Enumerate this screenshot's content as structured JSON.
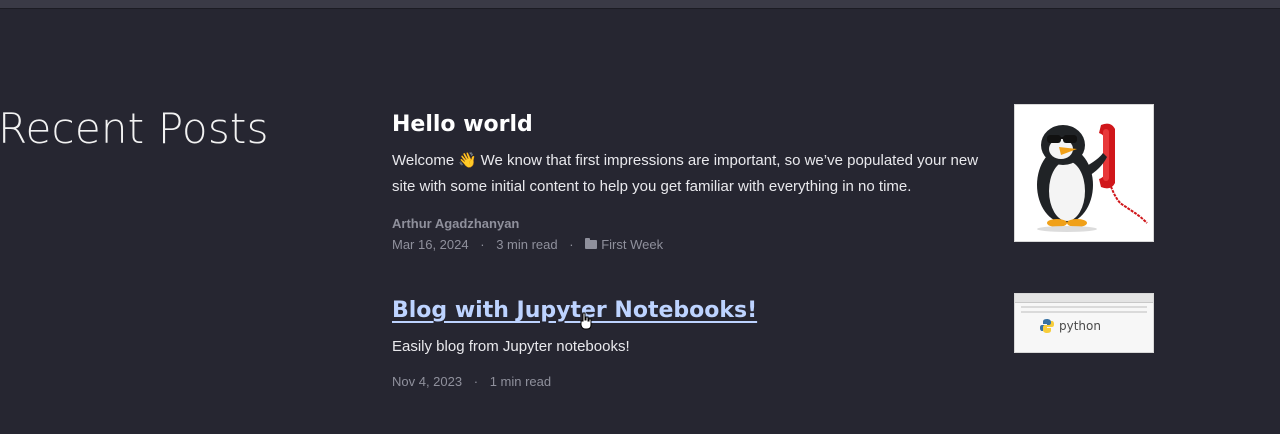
{
  "section_title": "Recent Posts",
  "posts": [
    {
      "title": "Hello world",
      "summary_before_emoji": "Welcome ",
      "emoji": "👋",
      "summary_after_emoji": " We know that first impressions are important, so we’ve populated your new site with some initial content to help you get familiar with everything in no time.",
      "author": "Arthur Agadzhanyan",
      "date": "Mar 16, 2024",
      "read_time": "3 min read",
      "category": "First Week",
      "category_icon": "folder-icon",
      "thumbnail": "penguin-phone-illustration"
    },
    {
      "title": "Blog with Jupyter Notebooks!",
      "summary": "Easily blog from Jupyter notebooks!",
      "date": "Nov 4, 2023",
      "read_time": "1 min read",
      "thumbnail": "python-notebook-screenshot",
      "thumbnail_text": "python"
    }
  ],
  "separator": "·",
  "colors": {
    "background": "#262631",
    "link_hover": "#bdd3ff",
    "meta": "#8f909c"
  }
}
